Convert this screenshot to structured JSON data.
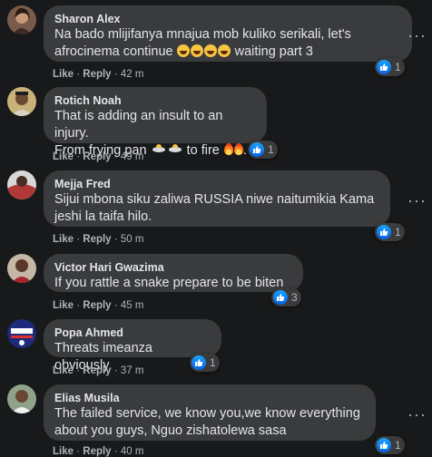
{
  "actions": {
    "like": "Like",
    "reply": "Reply",
    "separator": "·"
  },
  "comments": [
    {
      "author": "Sharon Alex",
      "line1": "Na bado mlijifanya mnajua mob kuliko serikali, let's",
      "line2": "afrocinema continue",
      "line2_tail": "waiting part 3",
      "time": "42 m",
      "reactions": "1"
    },
    {
      "author": "Rotich Noah",
      "line1": "That is adding an insult to an injury.",
      "line2": "From frying pan",
      "line2_mid": "to fire",
      "time": "49 m",
      "reactions": "1"
    },
    {
      "author": "Mejja Fred",
      "line1": "Sijui mbona siku zaliwa RUSSIA niwe naitumikia Kama",
      "line2": "jeshi la taifa hilo.",
      "time": "50 m",
      "reactions": "1"
    },
    {
      "author": "Victor Hari Gwazima",
      "line1": "If you rattle a snake prepare to be biten",
      "time": "45 m",
      "reactions": "3"
    },
    {
      "author": "Popa Ahmed",
      "line1": "Threats imeanza obviously",
      "time": "37 m",
      "reactions": "1"
    },
    {
      "author": "Elias Musila",
      "line1": "The failed service, we know you,we know everything",
      "line2": "about you guys, Nguo zishatolewa sasa",
      "time": "40 m",
      "reactions": "1"
    }
  ],
  "icons": {
    "like": "like-thumb-icon",
    "more": "more-dots-icon"
  },
  "colors": {
    "background": "#18191a",
    "bubble": "#3a3b3c",
    "text": "#e4e6eb",
    "meta": "#b0b3b8",
    "like_blue": "#0763e6"
  }
}
